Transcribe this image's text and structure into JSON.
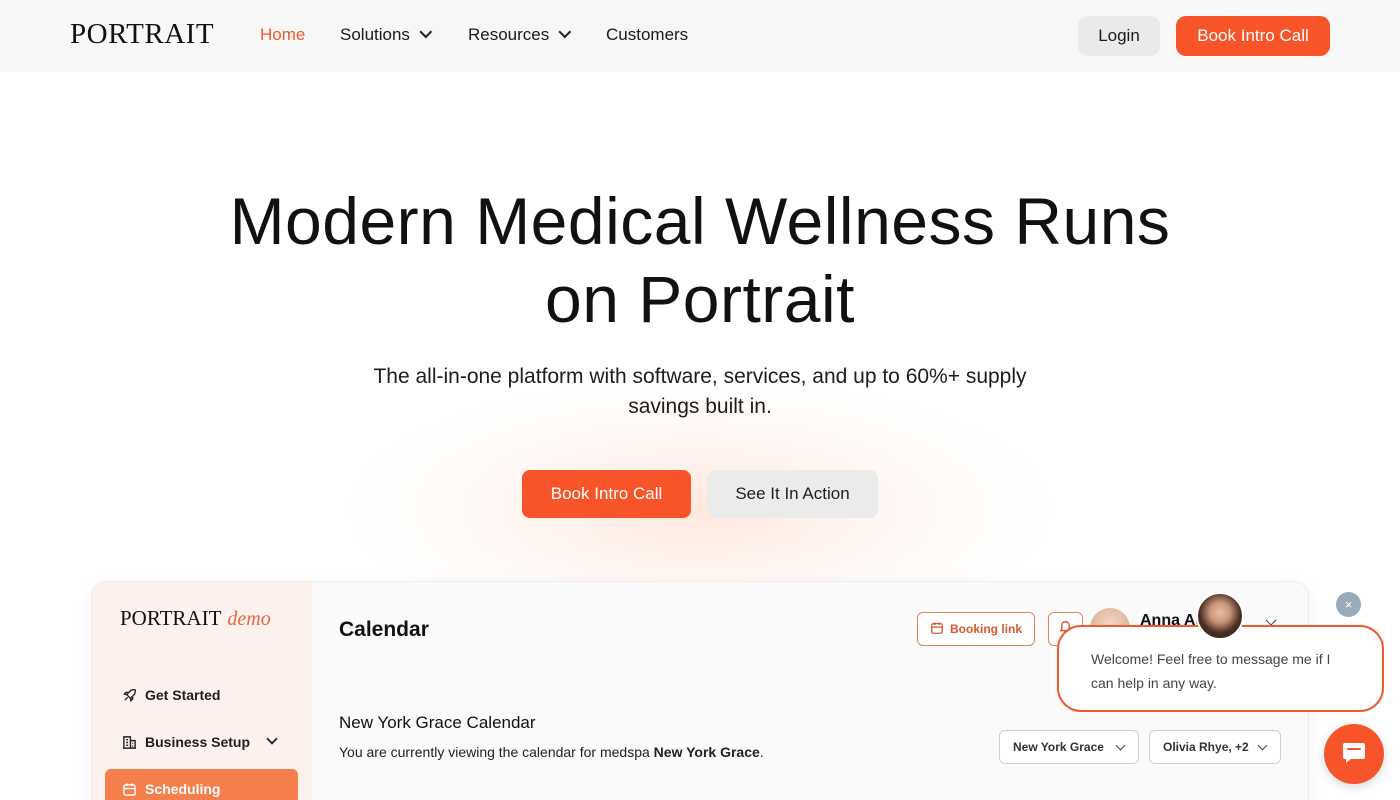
{
  "brand": {
    "logo_text": "PORTRAIT",
    "accent_color": "#f7542a"
  },
  "nav": {
    "home": "Home",
    "solutions": "Solutions",
    "resources": "Resources",
    "customers": "Customers",
    "login": "Login",
    "book_intro_call": "Book Intro Call"
  },
  "hero": {
    "title_line1": "Modern Medical Wellness Runs",
    "title_line2": "on Portrait",
    "subtitle_line1": "The all-in-one platform with software, services, and up to 60%+ supply",
    "subtitle_line2": "savings built in.",
    "primary_cta": "Book Intro Call",
    "secondary_cta": "See It In Action"
  },
  "app_preview": {
    "logo_text": "PORTRAIT",
    "logo_suffix": "demo",
    "sidebar": {
      "items": [
        {
          "label": "Get Started",
          "icon": "rocket-icon"
        },
        {
          "label": "Business Setup",
          "icon": "building-icon"
        },
        {
          "label": "Scheduling",
          "icon": "calendar-icon"
        }
      ]
    },
    "page_title": "Calendar",
    "booking_link_label": "Booking link",
    "user_name": "Anna Au",
    "calendar_title": "New York Grace Calendar",
    "calendar_desc_prefix": "You are currently viewing the calendar for medspa ",
    "calendar_desc_location": "New York Grace",
    "calendar_desc_suffix": ".",
    "location_select": "New York Grace",
    "staff_select": "Olivia Rhye, +2"
  },
  "chat": {
    "close_label": "×",
    "message_line1": "Welcome! Feel free to message me if I",
    "message_line2": "can help in any way."
  }
}
